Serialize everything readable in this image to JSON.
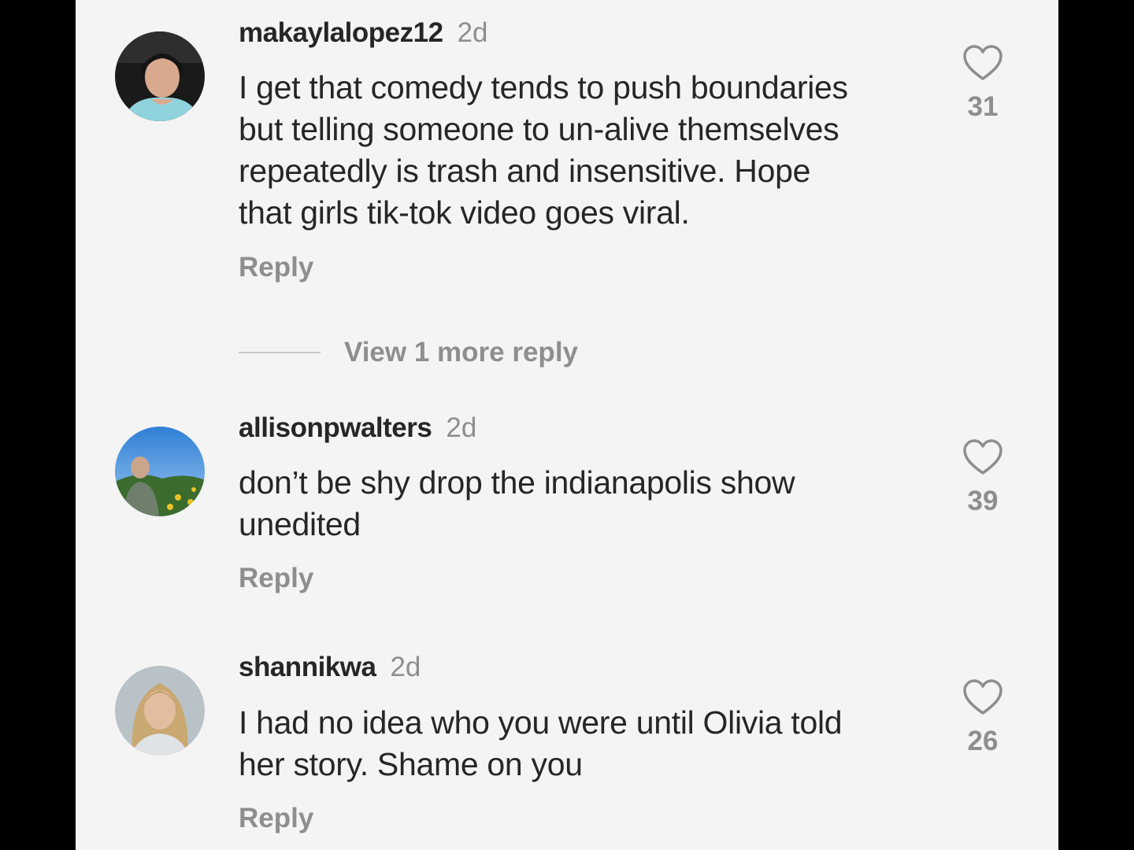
{
  "comments": [
    {
      "username": "makaylalopez12",
      "time": "2d",
      "text_lines": [
        "I get that comedy tends to push boundaries",
        "but telling someone to un-alive themselves",
        "repeatedly is trash and insensitive. Hope",
        "that girls tik-tok video goes viral."
      ],
      "reply_label": "Reply",
      "likes": "31",
      "like_icon": "heart-outline-icon"
    },
    {
      "username": "allisonpwalters",
      "time": "2d",
      "text_lines": [
        "don’t be shy drop the indianapolis show",
        "unedited"
      ],
      "reply_label": "Reply",
      "likes": "39",
      "like_icon": "heart-outline-icon"
    },
    {
      "username": "shannikwa",
      "time": "2d",
      "text_lines": [
        "I had no idea who you were until Olivia told",
        "her story. Shame on you"
      ],
      "reply_label": "Reply",
      "likes": "26",
      "like_icon": "heart-outline-icon"
    }
  ],
  "view_more_replies": "View 1 more reply",
  "colors": {
    "background": "#f4f4f4",
    "primary_text": "#262626",
    "secondary_text": "#8e8e8e",
    "frame": "#000000"
  }
}
